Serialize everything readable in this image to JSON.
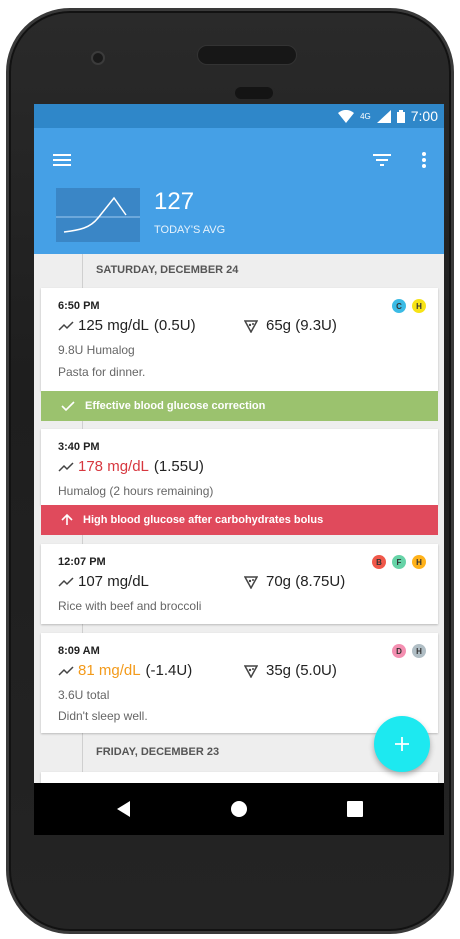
{
  "status_bar": {
    "time": "7:00",
    "network": "4G"
  },
  "app_bar": {
    "avg_value": "127",
    "avg_label": "TODAY'S AVG",
    "menu_icon": "hamburger-menu-icon",
    "filter_icon": "filter-icon",
    "more_icon": "more-vert-icon"
  },
  "days": [
    {
      "label": "SATURDAY, DECEMBER 24"
    },
    {
      "label": "FRIDAY, DECEMBER 23"
    }
  ],
  "entries": [
    {
      "time": "6:50 PM",
      "glucose": "125 mg/dL",
      "glucose_status": "normal",
      "insulin": "(0.5U)",
      "carbs": "65g (9.3U)",
      "line1": "9.8U Humalog",
      "line2": "Pasta for dinner.",
      "badges": [
        "C",
        "H"
      ],
      "badge_colors": [
        "#3bbbe5",
        "#f7e316"
      ]
    },
    {
      "time": "3:40 PM",
      "glucose": "178 mg/dL",
      "glucose_status": "high",
      "insulin": "(1.55U)",
      "line1": "Humalog (2 hours remaining)"
    },
    {
      "time": "12:07 PM",
      "glucose": "107 mg/dL",
      "glucose_status": "normal",
      "carbs": "70g (8.75U)",
      "line1": "Rice with beef and broccoli",
      "badges": [
        "B",
        "F",
        "H"
      ],
      "badge_colors": [
        "#f0584a",
        "#66d3a7",
        "#ffb21a"
      ]
    },
    {
      "time": "8:09 AM",
      "glucose": "81 mg/dL",
      "glucose_status": "low",
      "insulin": "(-1.4U)",
      "carbs": "35g (5.0U)",
      "line1": "3.6U total",
      "line2": "Didn't sleep well.",
      "badges": [
        "D",
        "H"
      ],
      "badge_colors": [
        "#f48fb1",
        "#b0bec5"
      ]
    }
  ],
  "alerts": [
    {
      "text": "Effective blood glucose correction",
      "color": "#9bc26e",
      "icon": "check-icon"
    },
    {
      "text": "High blood glucose after carbohydrates bolus",
      "color": "#e04a5c",
      "icon": "arrow-up-icon"
    }
  ],
  "fab": {
    "icon": "plus-icon"
  },
  "colors": {
    "status_bar": "#2f87c9",
    "app_bar": "#45a0e6",
    "high": "#d7373f",
    "low": "#f39a1a",
    "fab": "#1de9f0"
  }
}
